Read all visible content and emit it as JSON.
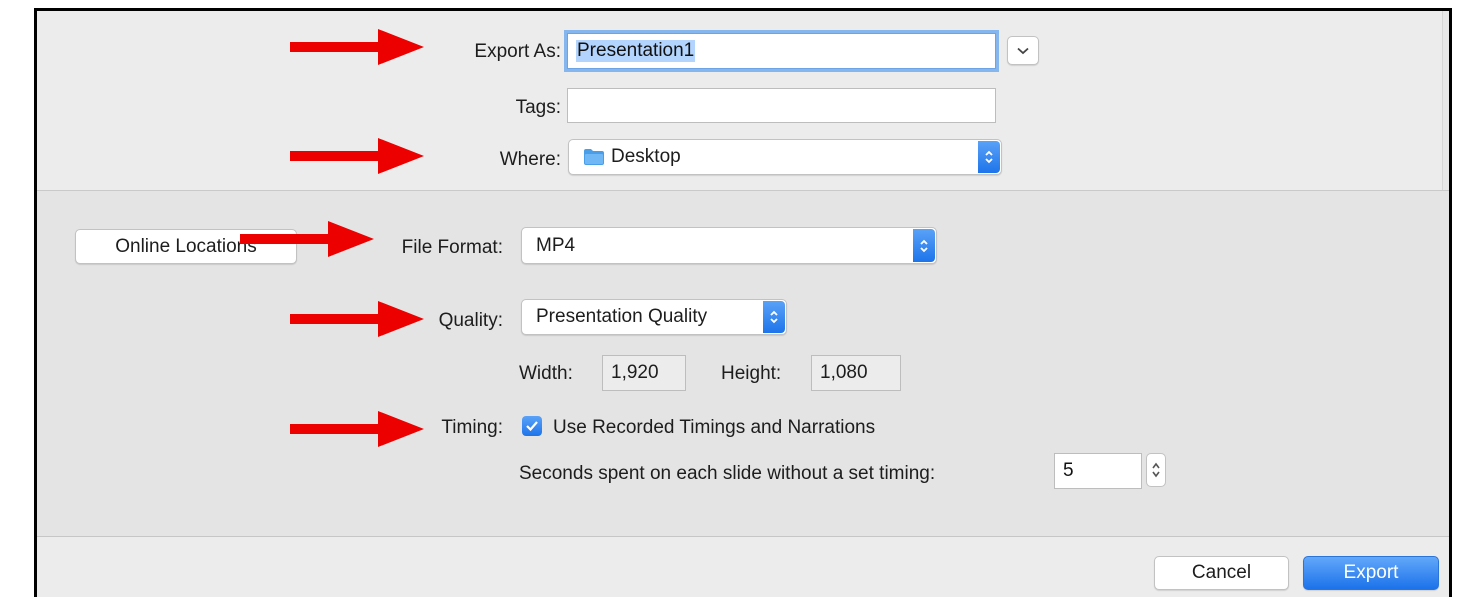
{
  "dialog": {
    "export_as": {
      "label": "Export As:",
      "value": "Presentation1"
    },
    "tags": {
      "label": "Tags:",
      "value": ""
    },
    "where": {
      "label": "Where:",
      "value": "Desktop",
      "icon": "folder-icon"
    },
    "online_locations_label": "Online Locations",
    "file_format": {
      "label": "File Format:",
      "value": "MP4"
    },
    "quality": {
      "label": "Quality:",
      "value": "Presentation Quality"
    },
    "width": {
      "label": "Width:",
      "value": "1,920"
    },
    "height": {
      "label": "Height:",
      "value": "1,080"
    },
    "timing": {
      "label": "Timing:",
      "checkbox_label": "Use Recorded Timings and Narrations",
      "checked": true,
      "seconds_label": "Seconds spent on each slide without a set timing:",
      "seconds_value": "5"
    },
    "cancel_label": "Cancel",
    "export_label": "Export"
  },
  "colors": {
    "accent": "#1d74ea",
    "annotation_arrow": "#ec0000"
  }
}
